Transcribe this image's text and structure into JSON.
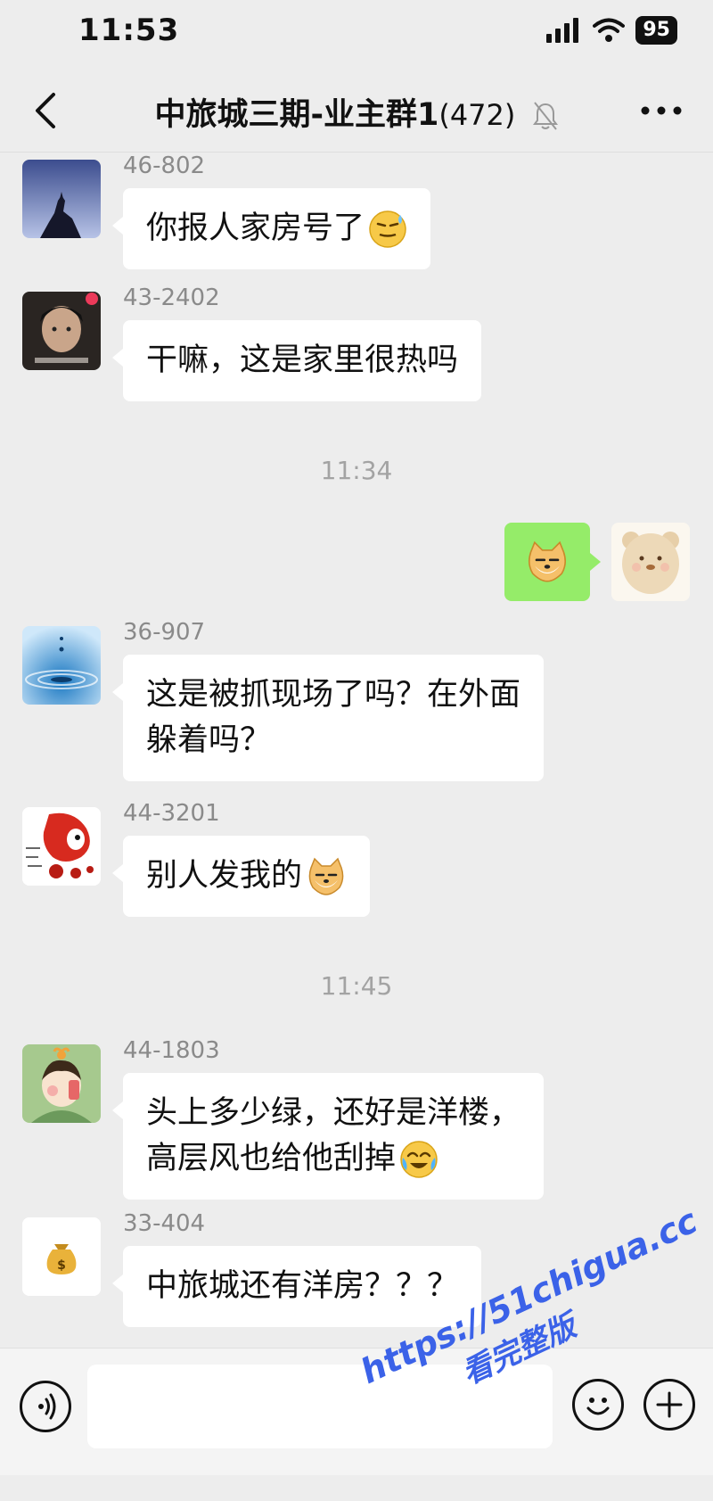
{
  "status_bar": {
    "time": "11:53",
    "battery": "95"
  },
  "nav": {
    "title": "中旅城三期-业主群1",
    "member_count": "(472)"
  },
  "messages": [
    {
      "sender": "46-802",
      "text": "你报人家房号了"
    },
    {
      "sender": "43-2402",
      "text": "干嘛，这是家里很热吗"
    },
    {
      "sender": "36-907",
      "text": "这是被抓现场了吗？在外面\n躲着吗？"
    },
    {
      "sender": "44-3201",
      "text": "别人发我的"
    },
    {
      "sender": "44-1803",
      "text": "头上多少绿，还好是洋楼，\n高层风也给他刮掉"
    },
    {
      "sender": "33-404",
      "text": "中旅城还有洋房？？？"
    }
  ],
  "timestamps": [
    "11:34",
    "11:45"
  ],
  "watermark": {
    "url": "https://51chigua.cc",
    "caption": "看完整版"
  },
  "colors": {
    "self_bubble": "#95ec69",
    "background": "#ededed",
    "watermark": "#3b62e8"
  }
}
